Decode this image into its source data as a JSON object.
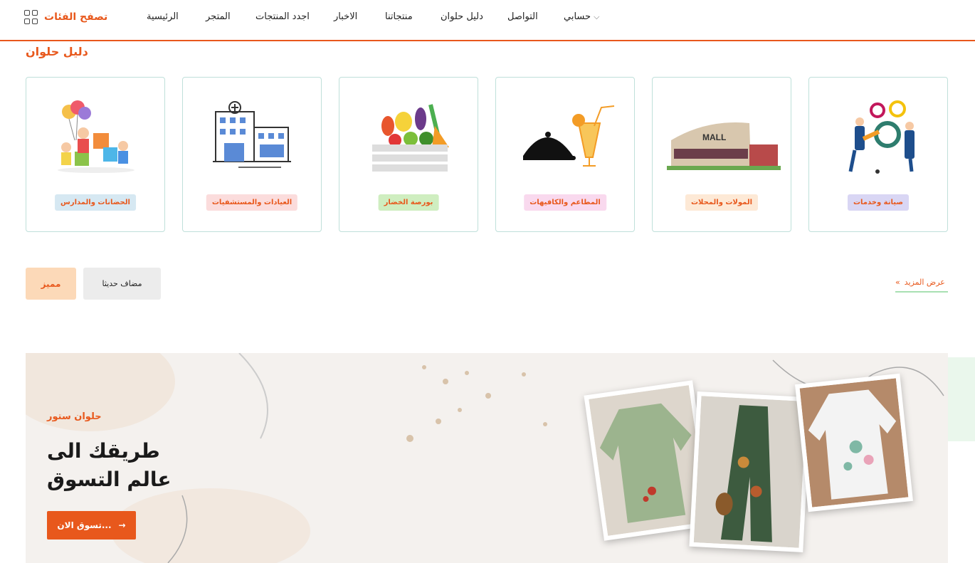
{
  "header": {
    "browse_label": "تصفح الفئات",
    "nav": {
      "home": "الرئيسية",
      "store": "المتجر",
      "newest_products": "اجدد المنتجات",
      "news": "الاخبار",
      "our_products": "منتجاتنا",
      "helwan_guide": "دليل حلوان",
      "contact": "التواصل",
      "account": "حسابي"
    },
    "accent_color": "#e8581c"
  },
  "section_title": "دليل حلوان",
  "categories": [
    {
      "label": "صيانة وخدمات",
      "icon": "maintenance-gears-icon",
      "badge_bg": "#d9d6f4",
      "badge_color": "#e8581c"
    },
    {
      "label": "المولات والمحلات",
      "icon": "mall-building-icon",
      "badge_bg": "#fde9d6",
      "badge_color": "#e8581c"
    },
    {
      "label": "المطاعم والكافيهات",
      "icon": "restaurant-cloche-icon",
      "badge_bg": "#f9d9ee",
      "badge_color": "#e8581c"
    },
    {
      "label": "بورصة الخضار",
      "icon": "vegetable-crate-icon",
      "badge_bg": "#cfeec0",
      "badge_color": "#e8581c"
    },
    {
      "label": "العيادات والمستشفيات",
      "icon": "hospital-icon",
      "badge_bg": "#fbdcdc",
      "badge_color": "#e8581c"
    },
    {
      "label": "الحضانات والمدارس",
      "icon": "kids-balloons-icon",
      "badge_bg": "#d6e8f2",
      "badge_color": "#e8581c"
    }
  ],
  "filters": {
    "featured": "مميز",
    "recent": "مضاف حديثا"
  },
  "show_more": "عرض المزيد",
  "banner": {
    "store_name": "حلوان ستور",
    "headline_line1": "طريقك الى",
    "headline_line2": "عالم التسوق",
    "cta": "تسوق الان...",
    "cta_arrow": "→"
  }
}
